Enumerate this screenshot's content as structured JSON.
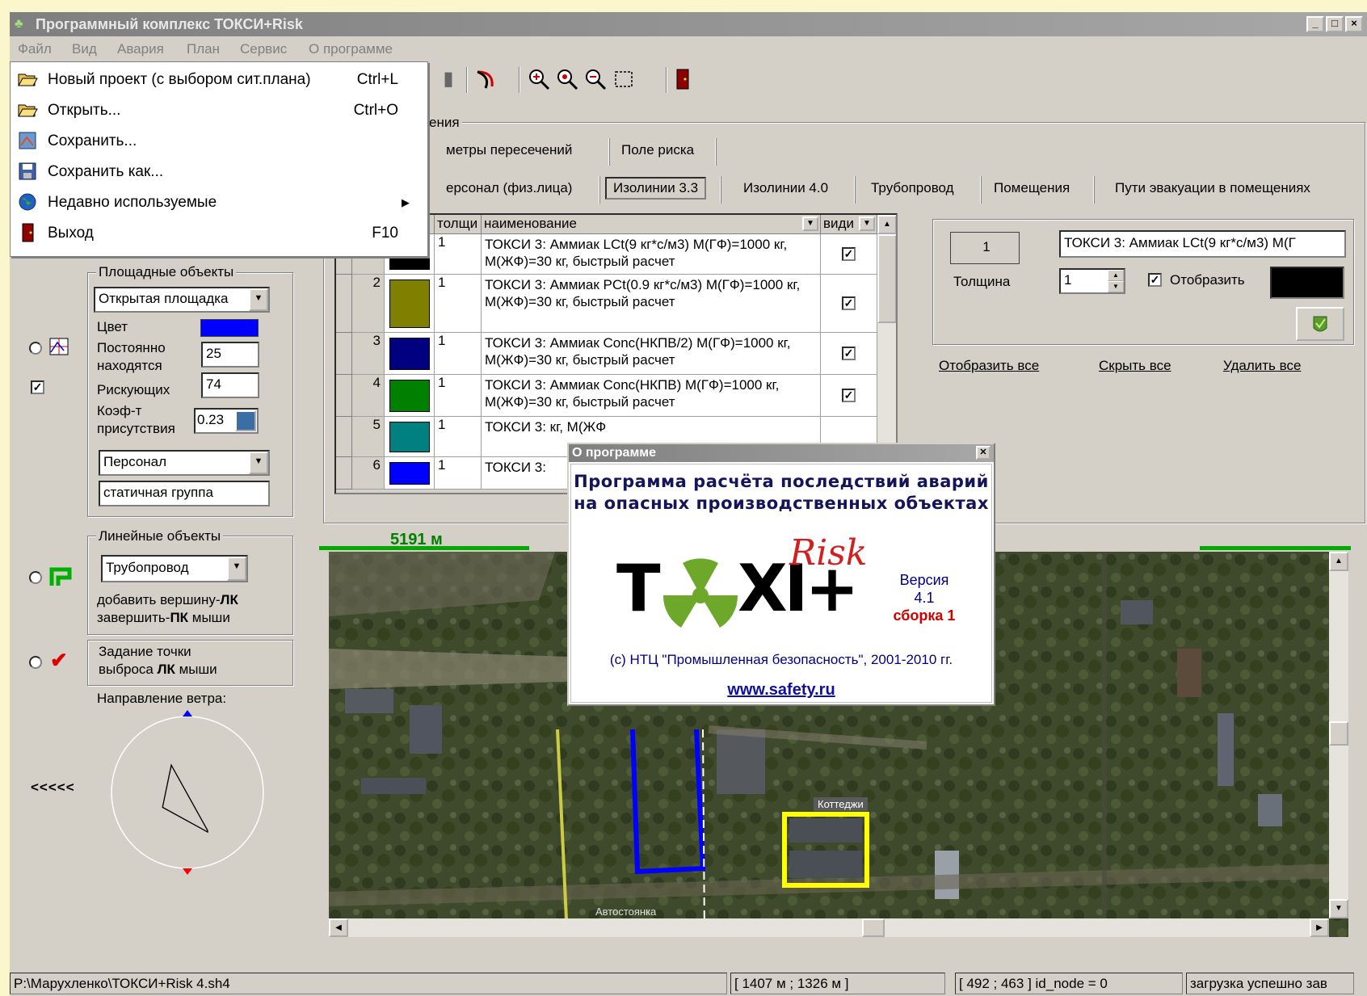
{
  "window": {
    "title": "Программный комплекс ТОКСИ+Risk",
    "controls": [
      "_",
      "□",
      "×"
    ]
  },
  "menubar": [
    "Файл",
    "Вид",
    "Авария",
    "План",
    "Сервис",
    "О программе"
  ],
  "file_menu": [
    {
      "label": "Новый проект (с выбором сит.плана)",
      "shortcut": "Ctrl+L",
      "icon": "folder-open-icon"
    },
    {
      "label": "Открыть...",
      "shortcut": "Ctrl+O",
      "icon": "folder-open-icon"
    },
    {
      "label": "Сохранить...",
      "shortcut": "",
      "icon": "save-chart-icon"
    },
    {
      "label": "Сохранить как...",
      "shortcut": "",
      "icon": "floppy-icon"
    },
    {
      "label": "Недавно используемые",
      "shortcut": "",
      "icon": "globe-icon",
      "submenu": true
    },
    {
      "label": "Выход",
      "shortcut": "F10",
      "icon": "exit-door-icon"
    }
  ],
  "toolbar_icons": [
    "redo-arrow-icon",
    "zoom-in-icon",
    "zoom-fit-icon",
    "zoom-out-icon",
    "select-rect-icon",
    "exit-door-icon"
  ],
  "top_group": {
    "title_fragment": "ения"
  },
  "tabs_row1": [
    "метры пересечений",
    "Поле риска"
  ],
  "tabs_row2": [
    {
      "label": "ерсонал (физ.лица)",
      "selected": false
    },
    {
      "label": "Изолинии 3.3",
      "selected": true
    },
    {
      "label": "Изолинии 4.0",
      "selected": false
    },
    {
      "label": "Трубопровод",
      "selected": false
    },
    {
      "label": "Помещения",
      "selected": false
    },
    {
      "label": "Пути эвакуации в помещениях",
      "selected": false
    }
  ],
  "grid": {
    "headers": {
      "num": "",
      "color": "",
      "thickness": "толщи",
      "name": "наименование",
      "visible": "види"
    },
    "rows": [
      {
        "num": "",
        "color": "#000000",
        "thickness": "1",
        "name": "ТОКСИ 3: Аммиак LCt(9 кг*с/м3) М(ГФ)=1000 кг, М(ЖФ)=30 кг, быстрый расчет",
        "visible": "✓"
      },
      {
        "num": "2",
        "color": "#808000",
        "thickness": "1",
        "name": "ТОКСИ 3: Аммиак PCt(0.9 кг*с/м3) М(ГФ)=1000 кг, М(ЖФ)=30 кг,  быстрый расчет",
        "visible": "✓"
      },
      {
        "num": "3",
        "color": "#000080",
        "thickness": "1",
        "name": "ТОКСИ 3: Аммиак Conc(НКПВ/2) М(ГФ)=1000 кг, М(ЖФ)=30 кг,  быстрый расчет",
        "visible": "✓"
      },
      {
        "num": "4",
        "color": "#008000",
        "thickness": "1",
        "name": "ТОКСИ 3: Аммиак Conc(НКПВ) М(ГФ)=1000 кг, М(ЖФ)=30 кг,  быстрый расчет",
        "visible": "✓"
      },
      {
        "num": "5",
        "color": "#008080",
        "thickness": "1",
        "name": "ТОКСИ 3: кг, М(ЖФ",
        "visible": ""
      },
      {
        "num": "6",
        "color": "#0000ff",
        "thickness": "1",
        "name": "ТОКСИ 3:",
        "visible": ""
      }
    ]
  },
  "props_panel": {
    "index_value": "1",
    "name_value": "ТОКСИ 3: Аммиак LCt(9 кг*с/м3) М(Г",
    "thickness_label": "Толщина",
    "thickness_value": "1",
    "show_label": "Отобразить",
    "show_checked": "✓",
    "swatch_color": "#000000",
    "links": [
      "Отобразить все",
      "Скрыть все",
      "Удалить все"
    ]
  },
  "area_objects": {
    "title": "Площадные объекты",
    "type_value": "Открытая площадка",
    "color_label": "Цвет",
    "color_value": "#0000ff",
    "permanent_label": "Постоянно находятся",
    "permanent_value": "25",
    "risk_label": "Рискующих",
    "risk_value": "74",
    "coef_label": "Коэф-т присутствия",
    "coef_value": "0.23",
    "personnel_value": "Персонал",
    "group_value": "статичная группа",
    "left_checkbox": "✓"
  },
  "line_objects": {
    "title": "Линейные объекты",
    "type_value": "Трубопровод",
    "hint_line1_prefix": "добавить вершину-",
    "hint_line1_key": "ЛК",
    "hint_line2_prefix": "завершить-",
    "hint_line2_key": "ПК",
    "hint_line2_suffix": " мыши"
  },
  "release_point": {
    "line1": "Задание точки",
    "line2_prefix": "выброса ",
    "line2_key": "ЛК",
    "line2_suffix": " мыши"
  },
  "wind": {
    "label": "Направление ветра:",
    "arrows": "<<<<<"
  },
  "map": {
    "scale": "5191 м",
    "label_cottages": "Коттеджи",
    "label_parking": "Автостоянка"
  },
  "about": {
    "title": "О программе",
    "headline1": "Программа расчёта последствий аварий",
    "headline2": "на опасных производственных объектах",
    "logo_left": "T",
    "logo_right": "XI+",
    "logo_risk": "Risk",
    "version_label": "Версия",
    "version_number": "4.1",
    "build": "сборка 1",
    "copyright": "(с) НТЦ \"Промышленная безопасность\", 2001-2010 гг.",
    "url": "www.safety.ru"
  },
  "statusbar": {
    "path": "P:\\Марухленко\\ТОКСИ+Risk 4.sh4",
    "coords_m": "[ 1407 м ; 1326 м ]",
    "coords_px": "[ 492 ; 463 ]  id_node = 0",
    "message": "загрузка успешно зав"
  }
}
